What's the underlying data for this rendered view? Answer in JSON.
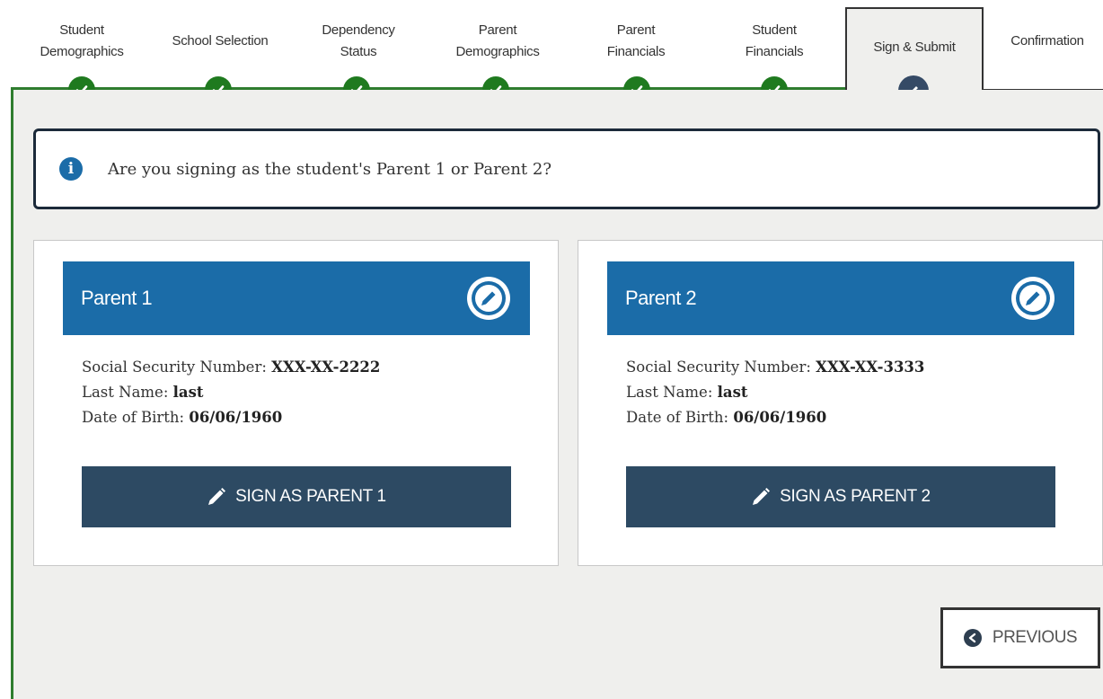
{
  "steps": [
    {
      "label_line1": "Student",
      "label_line2": "Demographics",
      "status": "complete"
    },
    {
      "label_line1": "School Selection",
      "label_line2": "",
      "status": "complete"
    },
    {
      "label_line1": "Dependency",
      "label_line2": "Status",
      "status": "complete"
    },
    {
      "label_line1": "Parent",
      "label_line2": "Demographics",
      "status": "complete"
    },
    {
      "label_line1": "Parent",
      "label_line2": "Financials",
      "status": "complete"
    },
    {
      "label_line1": "Student",
      "label_line2": "Financials",
      "status": "complete"
    },
    {
      "label_line1": "Sign & Submit",
      "label_line2": "",
      "status": "active"
    },
    {
      "label_line1": "Confirmation",
      "label_line2": "",
      "status": "pending"
    }
  ],
  "info": {
    "icon": "info-icon",
    "text": "Are you signing as the student's Parent 1 or Parent 2?"
  },
  "parents": [
    {
      "title": "Parent 1",
      "ssn_label": "Social Security Number: ",
      "ssn_value": "XXX-XX-2222",
      "last_name_label": "Last Name: ",
      "last_name_value": "last",
      "dob_label": "Date of Birth: ",
      "dob_value": "06/06/1960",
      "button_label": "SIGN AS PARENT 1"
    },
    {
      "title": "Parent 2",
      "ssn_label": "Social Security Number: ",
      "ssn_value": "XXX-XX-3333",
      "last_name_label": "Last Name: ",
      "last_name_value": "last",
      "dob_label": "Date of Birth: ",
      "dob_value": "06/06/1960",
      "button_label": "SIGN AS PARENT 2"
    }
  ],
  "navigation": {
    "previous_label": "PREVIOUS"
  },
  "colors": {
    "complete": "#1f7a1f",
    "active": "#354a66",
    "card_header": "#1b6ca8",
    "button": "#2d4a63"
  }
}
